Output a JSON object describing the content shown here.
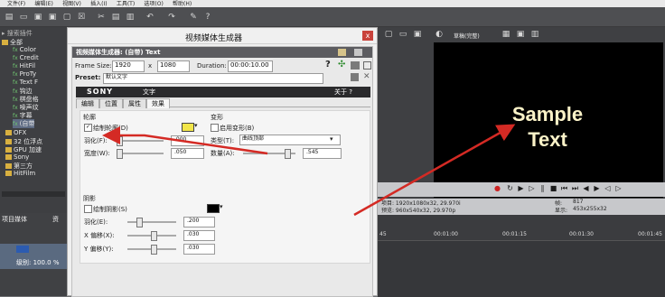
{
  "menubar": {
    "items": [
      "文件(F)",
      "编辑(E)",
      "视图(V)",
      "插入(I)",
      "工具(T)",
      "选项(O)",
      "帮助(H)"
    ]
  },
  "left_tree": {
    "header": "全部",
    "items": [
      "Color",
      "Credit",
      "HitFil",
      "ProTy",
      "Text F",
      "钩边",
      "棋盘格",
      "噪声纹",
      "字幕",
      "(自带",
      "OFX",
      "32 位浮点",
      "GPU 加速",
      "Sony",
      "第三方",
      "HitFilm"
    ]
  },
  "lower_left": {
    "tab1": "项目媒体",
    "tab2": "资",
    "level": "级别: 100.0 %"
  },
  "dialog": {
    "title": "视频媒体生成器",
    "close": "x",
    "plugin_title": "视频媒体生成器: (自带) Text",
    "frame_size_label": "Frame Size:",
    "width": "1920",
    "x_sep": "x",
    "height": "1080",
    "duration_label": "Duration:",
    "duration": "00:00:10.00",
    "preset_label": "Preset:",
    "preset_value": "默认文字",
    "sony_logo": "SONY",
    "sony_text": "文字",
    "about": "关于 ?",
    "tabs": [
      "编辑",
      "位置",
      "属性",
      "效果"
    ],
    "active_tab": 3,
    "outline_group": "轮廓",
    "draw_outline": "绘制轮廓(D)",
    "feather_label": "羽化(F):",
    "feather_value": ".000",
    "width_label": "宽度(W):",
    "width_value": ".050",
    "outline_color": "#f2e64a",
    "deform_group": "变形",
    "enable_deform": "启用变形(B)",
    "type_label": "类型(T):",
    "type_value": "曲线顶部",
    "amount_label": "数量(A):",
    "amount_value": ".545",
    "shadow_group": "阴影",
    "draw_shadow": "绘制阴影(S)",
    "shadow_feather_label": "羽化(E):",
    "shadow_feather_value": ".200",
    "x_offset_label": "X 偏移(X):",
    "x_offset_value": ".030",
    "y_offset_label": "Y 偏移(Y):",
    "y_offset_value": ".030",
    "shadow_color": "#000000"
  },
  "preview": {
    "quality": "草稿(完整)",
    "sample_line1": "Sample",
    "sample_line2": "Text",
    "project_info": "项目: 1920x1080x32, 29.970i",
    "preview_info": "预览: 960x540x32, 29.970p",
    "frame_label": "帧:",
    "frame_value": "817",
    "display_label": "显示:",
    "display_value": "453x255x32"
  },
  "timeline": {
    "ticks": [
      "45",
      "00:01:00",
      "00:01:15",
      "00:01:30",
      "00:01:45"
    ]
  },
  "colors": {
    "arrow": "#d42a24",
    "video_bg": "#000000",
    "sample_text": "#fcf3c8"
  }
}
